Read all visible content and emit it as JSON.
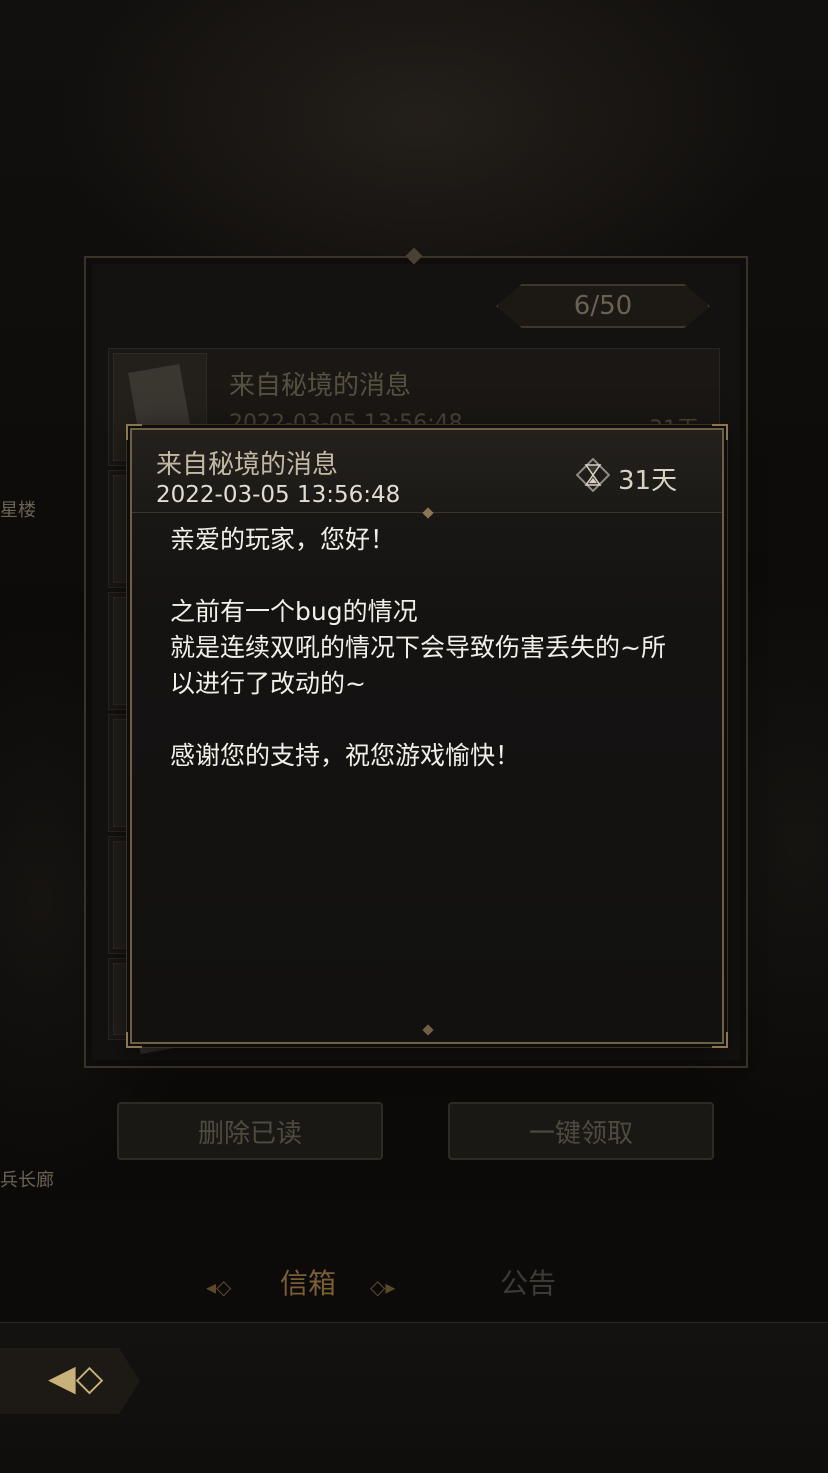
{
  "side_labels": {
    "left_upper": "星楼",
    "left_lower": "兵长廊"
  },
  "mail_list": {
    "counter": "6/50",
    "items": [
      {
        "title": "来自秘境的消息",
        "date": "2022-03-05 13:56:48",
        "days": "31天"
      }
    ]
  },
  "buttons": {
    "delete_read": "删除已读",
    "claim_all": "一键领取"
  },
  "tabs": {
    "mailbox": "信箱",
    "announcement": "公告"
  },
  "message": {
    "title": "来自秘境的消息",
    "date": "2022-03-05 13:56:48",
    "expire": "31天",
    "body": "亲爱的玩家，您好！\n\n之前有一个bug的情况\n就是连续双吼的情况下会导致伤害丢失的~所以进行了改动的~\n\n感谢您的支持，祝您游戏愉快！"
  },
  "colors": {
    "gold_accent": "#c9a96a",
    "active_tab": "#8a6a3a",
    "inactive_tab": "#3d3a35"
  },
  "icons": {
    "hourglass": "hourglass-icon",
    "back": "back-arrow-icon"
  }
}
